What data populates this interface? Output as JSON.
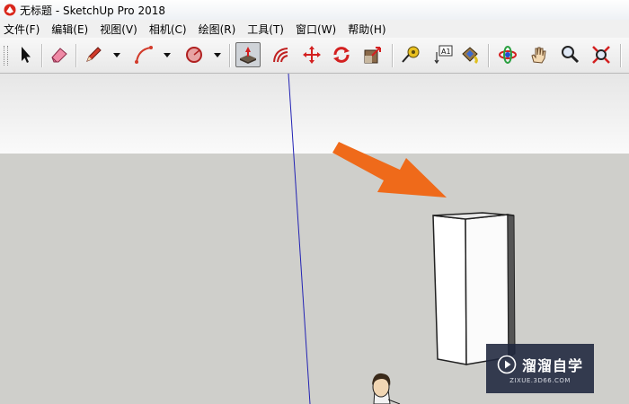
{
  "window": {
    "title": "无标题 - SketchUp Pro 2018",
    "app_icon": "sketchup-logo-icon"
  },
  "menubar": {
    "items": [
      {
        "label": "文件(F)"
      },
      {
        "label": "编辑(E)"
      },
      {
        "label": "视图(V)"
      },
      {
        "label": "相机(C)"
      },
      {
        "label": "绘图(R)"
      },
      {
        "label": "工具(T)"
      },
      {
        "label": "窗口(W)"
      },
      {
        "label": "帮助(H)"
      }
    ]
  },
  "toolbar": {
    "tools": [
      {
        "icon": "select-arrow-icon"
      },
      {
        "icon": "eraser-icon"
      },
      {
        "icon": "pencil-line-icon"
      },
      {
        "icon": "arc-icon"
      },
      {
        "icon": "shape-circle-icon"
      },
      {
        "icon": "push-pull-icon",
        "active": true
      },
      {
        "icon": "offset-icon"
      },
      {
        "icon": "move-icon"
      },
      {
        "icon": "rotate-icon"
      },
      {
        "icon": "scale-icon"
      },
      {
        "icon": "tape-measure-icon"
      },
      {
        "icon": "text-label-icon",
        "label": "A1"
      },
      {
        "icon": "paint-bucket-icon"
      },
      {
        "icon": "orbit-icon"
      },
      {
        "icon": "pan-hand-icon"
      },
      {
        "icon": "zoom-icon"
      },
      {
        "icon": "zoom-extents-icon"
      }
    ]
  },
  "colors": {
    "sky": "#f5f5f5",
    "ground": "#cfcfcb",
    "axis_blue": "#2323b4",
    "arrow_orange": "#ef6a1a",
    "watermark_bg": "#1e263c"
  },
  "watermark": {
    "name": "溜溜自学",
    "url": "ZIXUE.3D66.COM"
  }
}
